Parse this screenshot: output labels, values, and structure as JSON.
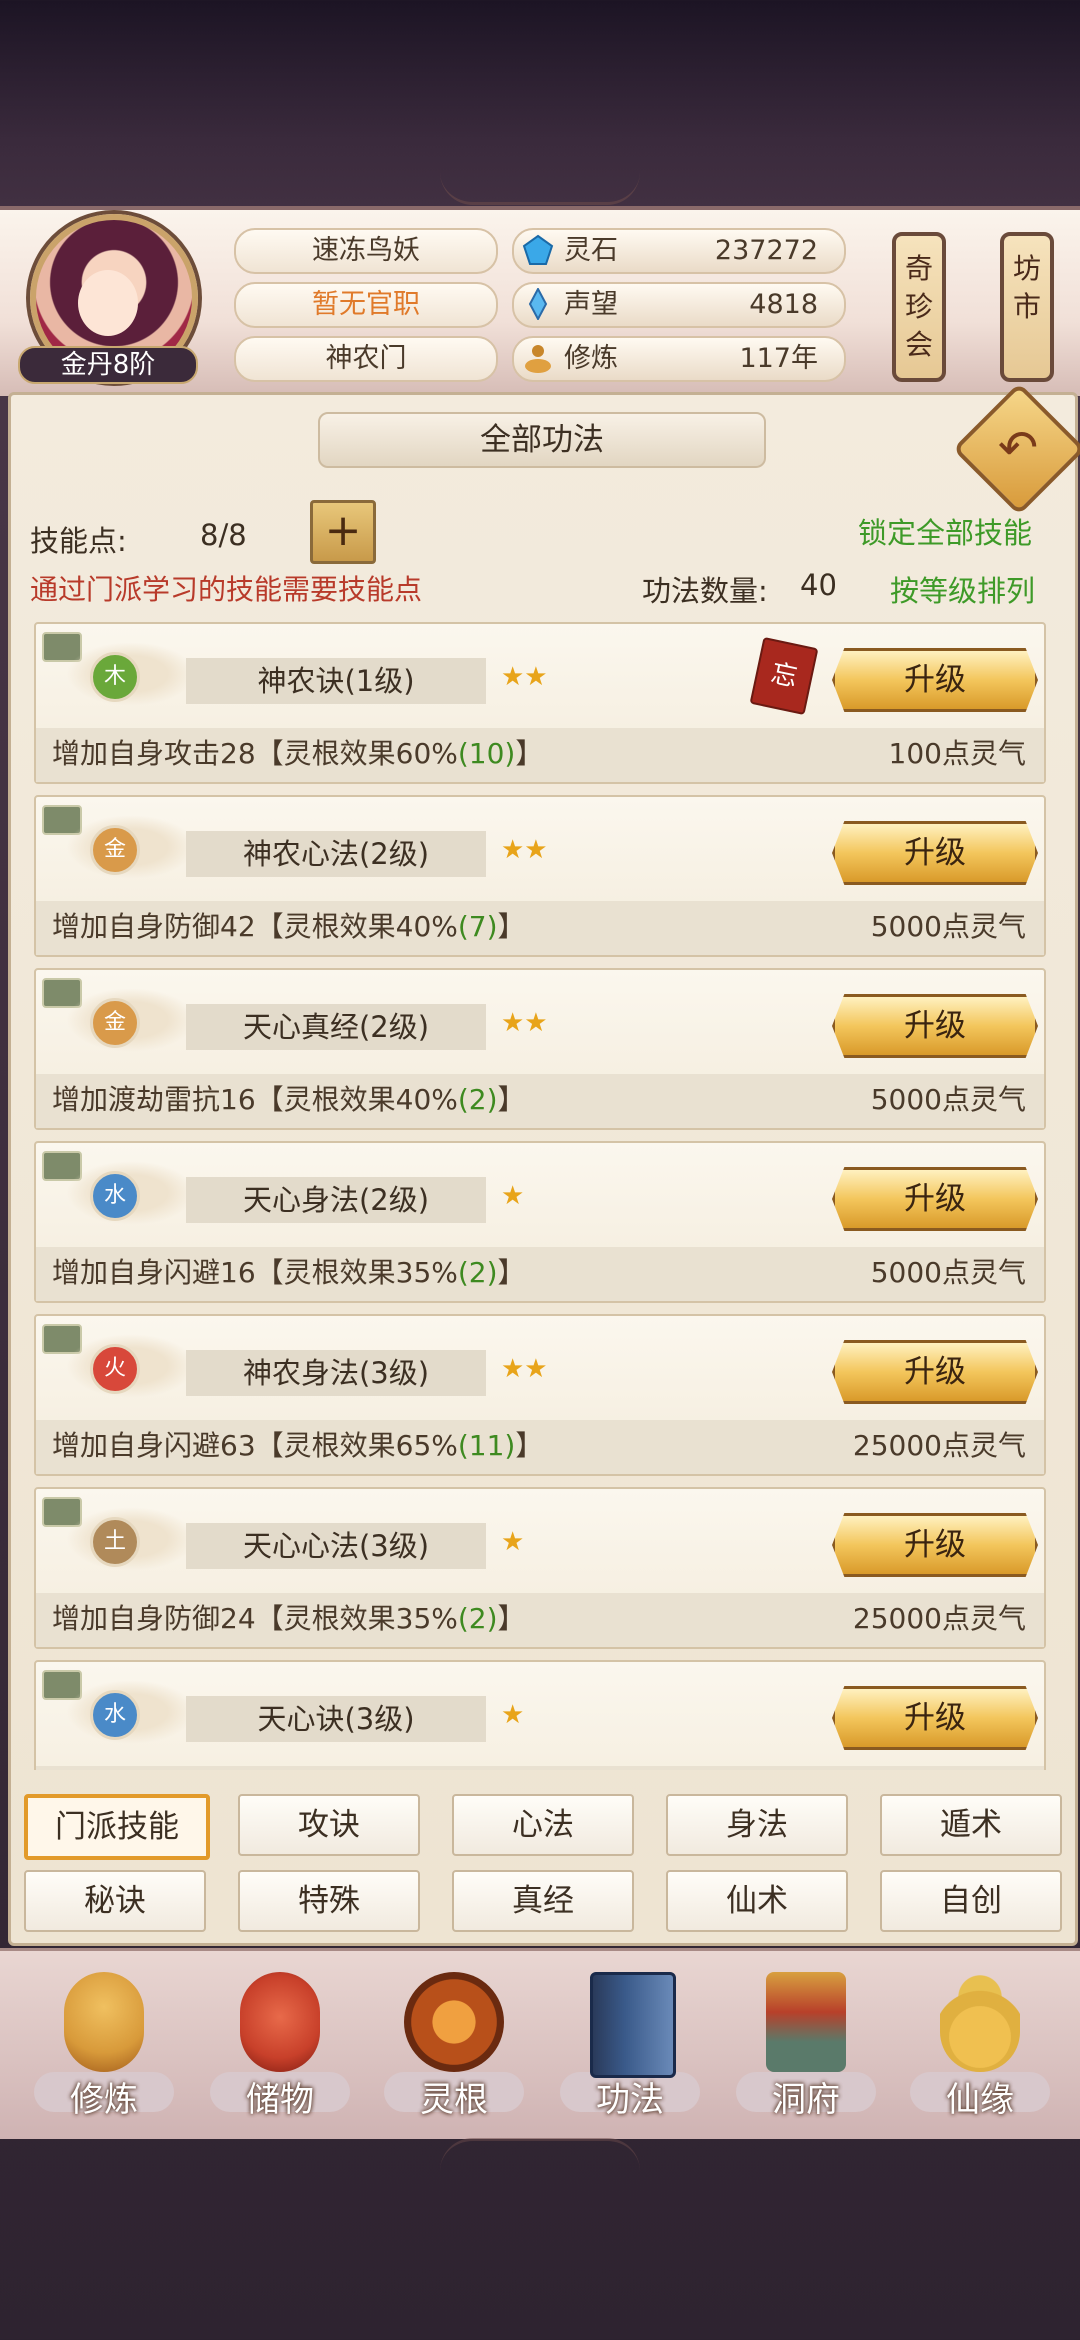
{
  "player": {
    "realm": "金丹8阶",
    "name": "速冻鸟妖",
    "official_title": "暂无官职",
    "sect": "神农门"
  },
  "resources": [
    {
      "label": "灵石",
      "value": "237272",
      "icon": "spirit-stone-icon"
    },
    {
      "label": "声望",
      "value": "4818",
      "icon": "prestige-crystal-icon"
    },
    {
      "label": "修炼",
      "value": "117年",
      "icon": "meditation-icon"
    }
  ],
  "side_buttons": {
    "treasure": "奇珍会",
    "market": "坊市"
  },
  "panel": {
    "title": "全部功法",
    "skill_points_label": "技能点:",
    "skill_points_value": "8/8",
    "note": "通过门派学习的技能需要技能点",
    "lock_all": "锁定全部技能",
    "technique_count_label": "功法数量:",
    "technique_count_value": "40",
    "sort_by_level": "按等级排列"
  },
  "skills": [
    {
      "element": "木",
      "element_color": "#6aa83a",
      "name": "神农诀(1级)",
      "stars": "★★",
      "upgrade": "升级",
      "desc_a": "增加自身攻击28【灵根效果60%",
      "desc_b": "(10)",
      "desc_c": "】",
      "cost": "100点灵气",
      "forget": "忘"
    },
    {
      "element": "金",
      "element_color": "#d99a4a",
      "name": "神农心法(2级)",
      "stars": "★★",
      "upgrade": "升级",
      "desc_a": "增加自身防御42【灵根效果40%",
      "desc_b": "(7)",
      "desc_c": "】",
      "cost": "5000点灵气"
    },
    {
      "element": "金",
      "element_color": "#d99a4a",
      "name": "天心真经(2级)",
      "stars": "★★",
      "upgrade": "升级",
      "desc_a": "增加渡劫雷抗16【灵根效果40%",
      "desc_b": "(2)",
      "desc_c": "】",
      "cost": "5000点灵气"
    },
    {
      "element": "水",
      "element_color": "#4a8ac8",
      "name": "天心身法(2级)",
      "stars": "★",
      "upgrade": "升级",
      "desc_a": "增加自身闪避16【灵根效果35%",
      "desc_b": "(2)",
      "desc_c": "】",
      "cost": "5000点灵气"
    },
    {
      "element": "火",
      "element_color": "#d8483a",
      "name": "神农身法(3级)",
      "stars": "★★",
      "upgrade": "升级",
      "desc_a": "增加自身闪避63【灵根效果65%",
      "desc_b": "(11)",
      "desc_c": "】",
      "cost": "25000点灵气"
    },
    {
      "element": "土",
      "element_color": "#b08a5a",
      "name": "天心心法(3级)",
      "stars": "★",
      "upgrade": "升级",
      "desc_a": "增加自身防御24【灵根效果35%",
      "desc_b": "(2)",
      "desc_c": "】",
      "cost": "25000点灵气"
    },
    {
      "element": "水",
      "element_color": "#4a8ac8",
      "name": "天心诀(3级)",
      "stars": "★",
      "upgrade": "升级"
    }
  ],
  "category_tabs": [
    "门派技能",
    "攻诀",
    "心法",
    "身法",
    "遁术",
    "秘诀",
    "特殊",
    "真经",
    "仙术",
    "自创"
  ],
  "active_tab": "门派技能",
  "bottom_nav": [
    {
      "label": "修炼",
      "icon": "cultivation-icon",
      "color": "#d89a3a"
    },
    {
      "label": "储物",
      "icon": "storage-bag-icon",
      "color": "#c8402a"
    },
    {
      "label": "灵根",
      "icon": "spirit-root-icon",
      "color": "#b8501a"
    },
    {
      "label": "功法",
      "icon": "technique-book-icon",
      "color": "#3a5a8a"
    },
    {
      "label": "洞府",
      "icon": "cave-mansion-icon",
      "color": "#b8402a"
    },
    {
      "label": "仙缘",
      "icon": "gourd-icon",
      "color": "#e0b040"
    }
  ],
  "colors": {
    "accent_gold": "#f3c65c",
    "note_red": "#b83a2a",
    "link_green": "#3e9a28",
    "active_tab_border": "#e29a2a"
  }
}
